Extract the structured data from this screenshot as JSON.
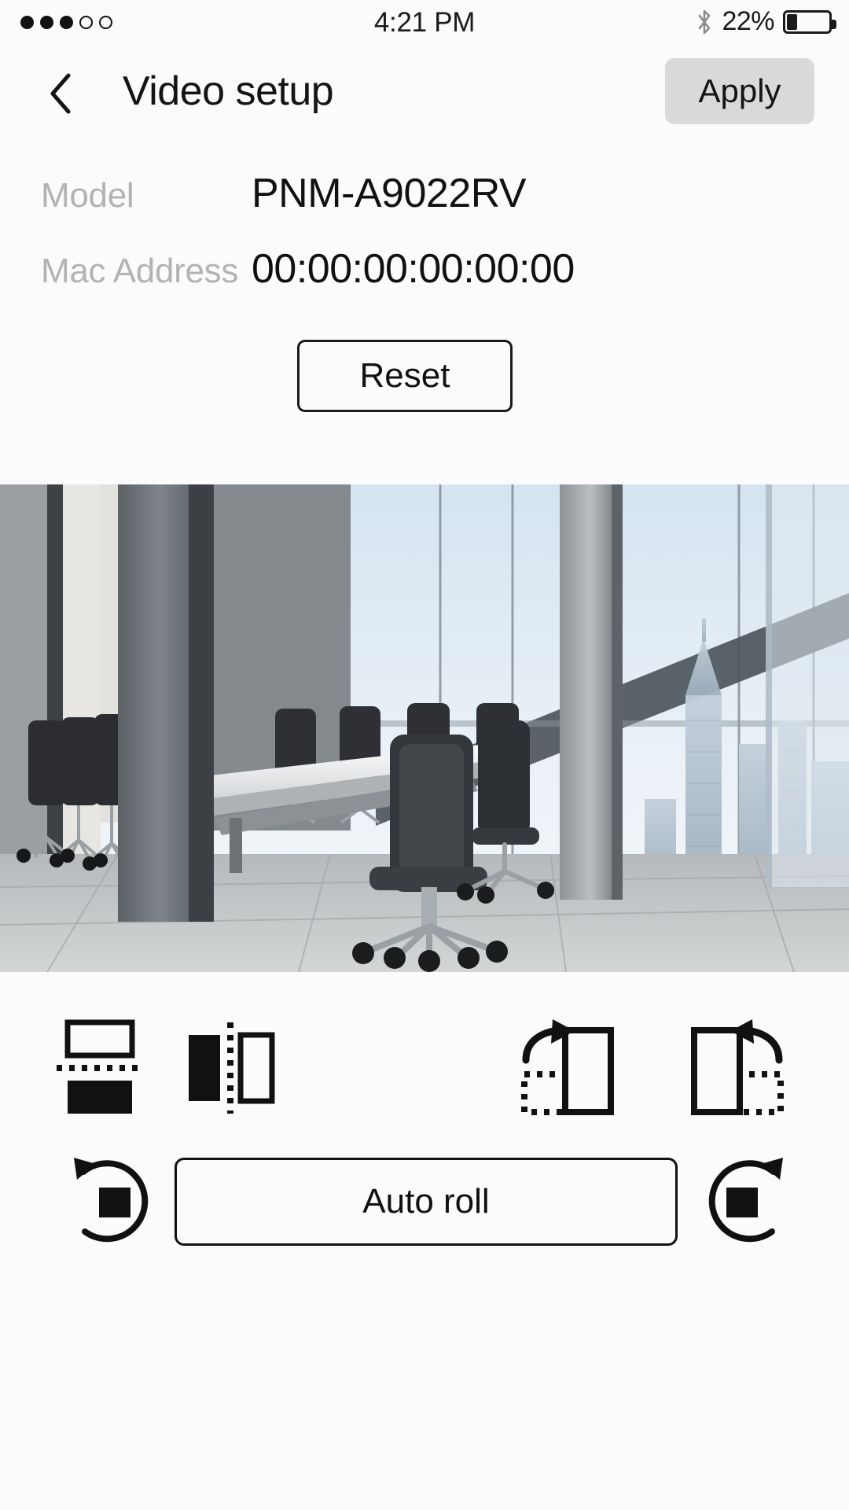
{
  "status_bar": {
    "signal_dots_total": 5,
    "signal_dots_filled": 3,
    "time": "4:21 PM",
    "bluetooth_icon": "bluetooth-icon",
    "battery_percent_label": "22%",
    "battery_fill_percent": 25
  },
  "header": {
    "back_icon": "chevron-left-icon",
    "title": "Video setup",
    "apply_label": "Apply",
    "apply_bg_color": "#d9d9d9"
  },
  "info": {
    "rows": [
      {
        "label": "Model",
        "value": "PNM-A9022RV"
      },
      {
        "label": "Mac Address",
        "value": "00:00:00:00:00:00"
      }
    ],
    "reset_label": "Reset",
    "label_color": "#b3b3b3",
    "value_color": "#111111"
  },
  "video_preview": {
    "description": "Modern conference room with long table, black chairs, concrete columns and floor-to-ceiling windows overlooking a city skyline"
  },
  "controls": {
    "transform_buttons": [
      {
        "name": "flip-vertical-icon",
        "label": "Flip vertical"
      },
      {
        "name": "flip-horizontal-icon",
        "label": "Flip horizontal"
      },
      {
        "name": "rotate-right-icon",
        "label": "Rotate right"
      },
      {
        "name": "rotate-left-icon",
        "label": "Rotate left"
      }
    ],
    "roll_left_icon": "roll-counterclockwise-icon",
    "roll_right_icon": "roll-clockwise-icon",
    "auto_roll_label": "Auto roll"
  }
}
